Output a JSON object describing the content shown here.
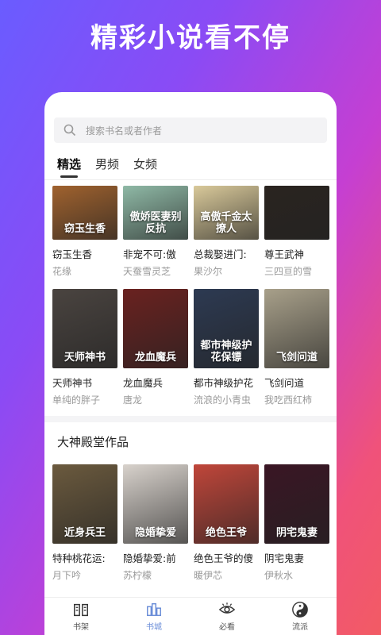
{
  "headline": "精彩小说看不停",
  "search": {
    "placeholder": "搜索书名或者作者"
  },
  "tabs": [
    {
      "label": "精选",
      "active": true
    },
    {
      "label": "男频",
      "active": false
    },
    {
      "label": "女频",
      "active": false
    }
  ],
  "featured_row1": [
    {
      "title": "窃玉生香",
      "author": "花缘",
      "cover_text": "窃玉生香",
      "color": "#a0622e"
    },
    {
      "title": "非宠不可:傲",
      "author": "天蚕雪灵芝",
      "cover_text": "傲娇医妻别反抗",
      "color": "#8fb9a6"
    },
    {
      "title": "总裁娶进门:",
      "author": "果沙尔",
      "cover_text": "高傲千金太撩人",
      "color": "#d9c99a"
    },
    {
      "title": "尊王武神",
      "author": "三四亘的雪",
      "cover_text": "",
      "color": "#2a2420"
    }
  ],
  "featured_row2": [
    {
      "title": "天师神书",
      "author": "单纯的胖子",
      "cover_text": "天师神书",
      "color": "#4a4440"
    },
    {
      "title": "龙血魔兵",
      "author": "唐龙",
      "cover_text": "龙血魔兵",
      "color": "#6a2220"
    },
    {
      "title": "都市神级护花",
      "author": "流浪的小青虫",
      "cover_text": "都市神级护花保镖",
      "color": "#2d3a52"
    },
    {
      "title": "飞剑问道",
      "author": "我吃西红柿",
      "cover_text": "飞剑问道",
      "color": "#a8a08a"
    }
  ],
  "section": {
    "title": "大神殿堂作品"
  },
  "masters": [
    {
      "title": "特种桃花运:",
      "author": "月下吟",
      "cover_text": "近身兵王",
      "color": "#6b5a3e"
    },
    {
      "title": "隐婚挚爱:前",
      "author": "苏柠檬",
      "cover_text": "隐婚挚爱",
      "color": "#d8d2cc"
    },
    {
      "title": "绝色王爷的傻",
      "author": "暖伊芯",
      "cover_text": "绝色王爷",
      "color": "#c0463a"
    },
    {
      "title": "阴宅鬼妻",
      "author": "伊秋水",
      "cover_text": "阴宅鬼妻",
      "color": "#3a1624"
    }
  ],
  "nav": [
    {
      "label": "书架",
      "icon": "book-open-icon",
      "active": false
    },
    {
      "label": "书城",
      "icon": "bookstore-icon",
      "active": true
    },
    {
      "label": "必看",
      "icon": "eye-icon",
      "active": false
    },
    {
      "label": "流派",
      "icon": "yin-yang-icon",
      "active": false
    }
  ],
  "colors": {
    "accent": "#6b8ed8",
    "text": "#222222",
    "muted": "#999999"
  }
}
